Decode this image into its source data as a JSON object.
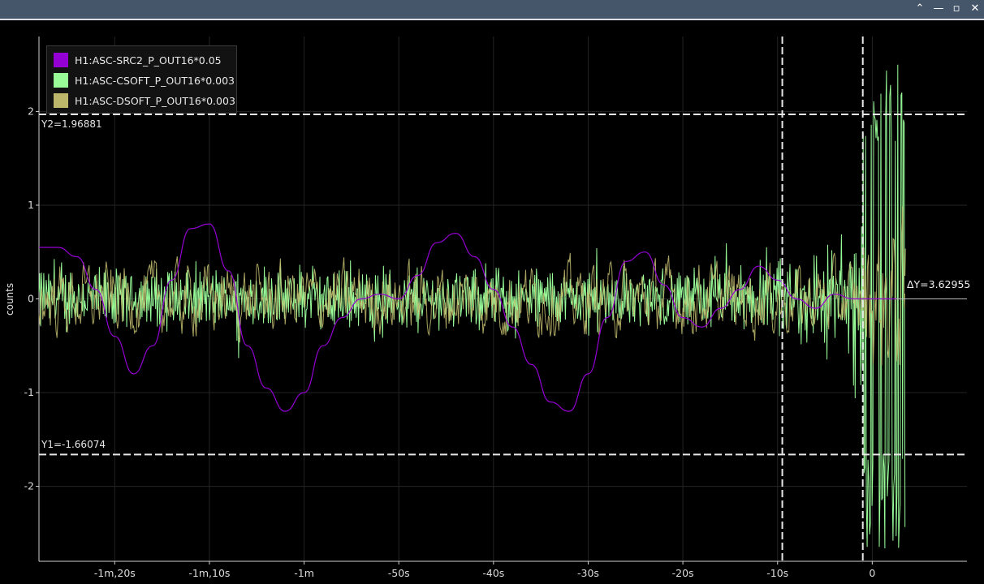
{
  "window": {
    "buttons": [
      {
        "name": "collapse-icon",
        "glyph": "⌃"
      },
      {
        "name": "minimize-icon",
        "glyph": "—"
      },
      {
        "name": "maximize-icon",
        "glyph": "▫"
      },
      {
        "name": "close-icon",
        "glyph": "✕"
      }
    ]
  },
  "chart_data": {
    "type": "line",
    "title": "",
    "xlabel": "",
    "ylabel": "counts",
    "xlim": [
      -88,
      10
    ],
    "ylim": [
      -2.8,
      2.8
    ],
    "x_ticks": [
      -80,
      -70,
      -60,
      -50,
      -40,
      -30,
      -20,
      -10,
      0
    ],
    "x_tick_labels": [
      "-1m,20s",
      "-1m,10s",
      "-1m",
      "-50s",
      "-40s",
      "-30s",
      "-20s",
      "-10s",
      "0"
    ],
    "y_ticks": [
      -2,
      -1,
      0,
      1,
      2
    ],
    "y_tick_labels": [
      "-2",
      "-1",
      "0",
      "1",
      "2"
    ],
    "grid": true,
    "legend_position": "top-left",
    "series": [
      {
        "name": "H1:ASC-SRC2_P_OUT16*0.05",
        "color": "#9400d3"
      },
      {
        "name": "H1:ASC-CSOFT_P_OUT16*0.003",
        "color": "#98fb98"
      },
      {
        "name": "H1:ASC-DSOFT_P_OUT16*0.003",
        "color": "#bdb76b"
      }
    ],
    "src2_points": [
      [
        -88,
        0.55
      ],
      [
        -86,
        0.55
      ],
      [
        -84,
        0.45
      ],
      [
        -82,
        0.1
      ],
      [
        -80,
        -0.4
      ],
      [
        -78,
        -0.8
      ],
      [
        -76,
        -0.5
      ],
      [
        -74,
        0.2
      ],
      [
        -72,
        0.75
      ],
      [
        -70,
        0.8
      ],
      [
        -68,
        0.3
      ],
      [
        -66,
        -0.5
      ],
      [
        -64,
        -0.95
      ],
      [
        -62,
        -1.2
      ],
      [
        -60,
        -1.0
      ],
      [
        -58,
        -0.5
      ],
      [
        -56,
        -0.2
      ],
      [
        -54,
        0.0
      ],
      [
        -52,
        0.05
      ],
      [
        -50,
        0.0
      ],
      [
        -48,
        0.25
      ],
      [
        -46,
        0.6
      ],
      [
        -44,
        0.7
      ],
      [
        -42,
        0.45
      ],
      [
        -40,
        0.1
      ],
      [
        -38,
        -0.3
      ],
      [
        -36,
        -0.7
      ],
      [
        -34,
        -1.1
      ],
      [
        -32,
        -1.2
      ],
      [
        -30,
        -0.8
      ],
      [
        -28,
        -0.2
      ],
      [
        -26,
        0.4
      ],
      [
        -24,
        0.5
      ],
      [
        -22,
        0.15
      ],
      [
        -20,
        -0.2
      ],
      [
        -18,
        -0.3
      ],
      [
        -16,
        -0.1
      ],
      [
        -14,
        0.1
      ],
      [
        -12,
        0.35
      ],
      [
        -10,
        0.2
      ],
      [
        -8,
        0.0
      ],
      [
        -6,
        -0.1
      ],
      [
        -4,
        0.05
      ],
      [
        -2,
        0.0
      ],
      [
        0,
        0.0
      ],
      [
        3,
        0.0
      ]
    ],
    "csoft_noise": {
      "amplitude_before": 0.65,
      "amplitude_after_neg10": 1.1,
      "end_spread": [
        -2.7,
        2.6
      ],
      "range": [
        -88,
        3.5
      ]
    },
    "dsoft_noise": {
      "amplitude": 0.3,
      "range": [
        -88,
        3.5
      ]
    },
    "cursors": {
      "x_lines": [
        -9.5,
        -1.0
      ],
      "y1": -1.66074,
      "y2": 1.96881,
      "y1_label": "Y1=-1.66074",
      "y2_label": "Y2=1.96881",
      "dy_label": "ΔY=3.62955"
    }
  }
}
